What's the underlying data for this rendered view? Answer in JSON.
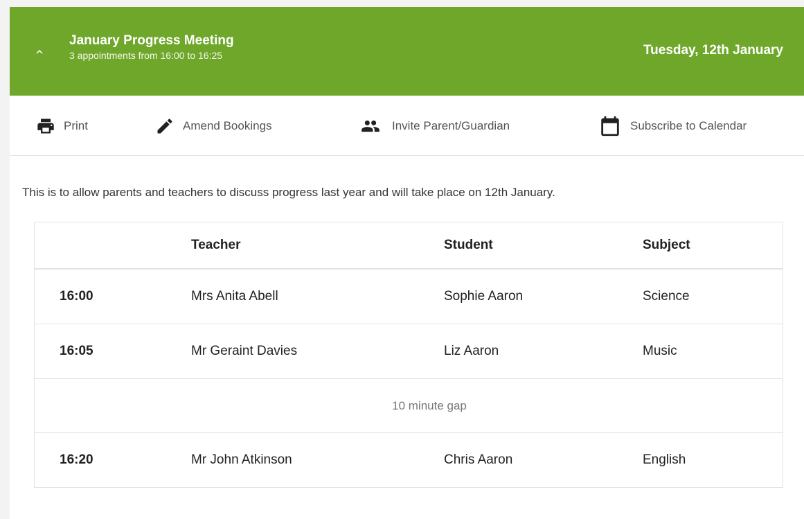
{
  "meeting": {
    "title": "January Progress Meeting",
    "subtitle": "3 appointments from 16:00 to 16:25",
    "date": "Tuesday, 12th January",
    "description": "This is to allow parents and teachers to discuss progress last year and will take place on 12th January."
  },
  "toolbar": {
    "print_label": "Print",
    "amend_label": "Amend Bookings",
    "invite_label": "Invite Parent/Guardian",
    "calendar_label": "Subscribe to Calendar"
  },
  "table": {
    "headers": [
      "",
      "Teacher",
      "Student",
      "Subject"
    ],
    "rows": [
      {
        "time": "16:00",
        "teacher": "Mrs Anita Abell",
        "student": "Sophie Aaron",
        "subject": "Science"
      },
      {
        "time": "16:05",
        "teacher": "Mr Geraint Davies",
        "student": "Liz Aaron",
        "subject": "Music"
      },
      {
        "gap": "10 minute gap"
      },
      {
        "time": "16:20",
        "teacher": "Mr John Atkinson",
        "student": "Chris Aaron",
        "subject": "English"
      }
    ]
  },
  "colors": {
    "header_green": "#6ea72a"
  },
  "icons": {
    "collapse": "chevron-up-icon",
    "print": "printer-icon",
    "amend": "pencil-icon",
    "invite": "people-icon",
    "calendar": "calendar-icon"
  }
}
